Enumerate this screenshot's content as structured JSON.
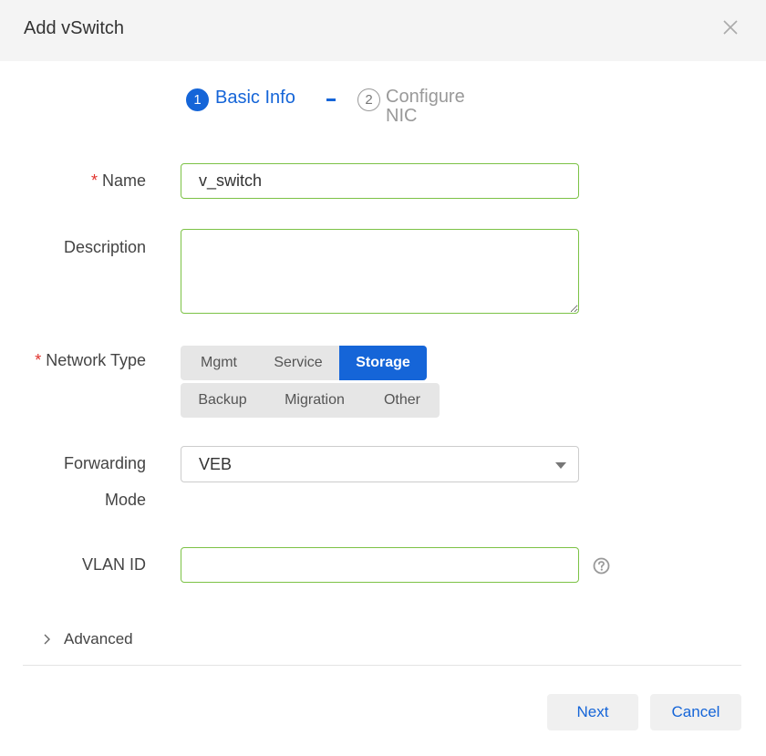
{
  "dialog": {
    "title": "Add vSwitch",
    "close_icon": "close-icon"
  },
  "steps": [
    {
      "number": "1",
      "label": "Basic Info",
      "state": "active"
    },
    {
      "number": "2",
      "label": "Configure NIC",
      "state": "inactive"
    }
  ],
  "form": {
    "required_mark": "*",
    "name": {
      "label": "Name",
      "value": "v_switch"
    },
    "description": {
      "label": "Description",
      "value": ""
    },
    "network_type": {
      "label": "Network Type",
      "options_row1": [
        "Mgmt",
        "Service",
        "Storage"
      ],
      "options_row2": [
        "Backup",
        "Migration",
        "Other"
      ],
      "selected": "Storage"
    },
    "forwarding_mode": {
      "label_line1": "Forwarding",
      "label_line2": "Mode",
      "value": "VEB"
    },
    "vlan_id": {
      "label": "VLAN ID",
      "value": "",
      "help_icon": "question-circle-icon"
    },
    "advanced": {
      "label": "Advanced",
      "icon": "chevron-right-icon"
    }
  },
  "footer": {
    "next_label": "Next",
    "cancel_label": "Cancel"
  },
  "colors": {
    "accent": "#1565d8",
    "valid_border": "#7cc246",
    "required": "#e0322c"
  }
}
